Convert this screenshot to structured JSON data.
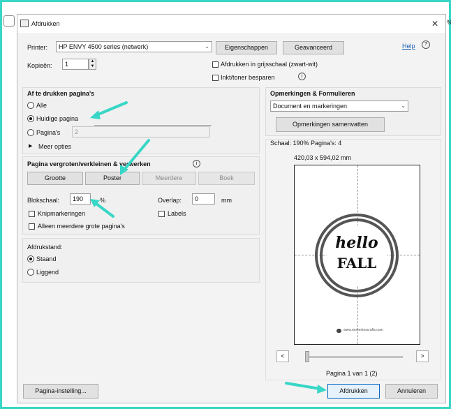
{
  "window": {
    "title": "Afdrukken",
    "close_glyph": "✕"
  },
  "printer": {
    "label": "Printer:",
    "selected": "HP ENVY 4500 series (netwerk)",
    "properties_button": "Eigenschappen",
    "advanced_button": "Geavanceerd",
    "help_link": "Help",
    "copies_label": "Kopieën:",
    "copies_value": "1",
    "grayscale_label": "Afdrukken in grijsschaal (zwart-wit)",
    "save_ink_label": "Inkt/toner besparen"
  },
  "pages": {
    "heading": "Af te drukken pagina's",
    "all": "Alle",
    "current": "Huidige pagina",
    "pages": "Pagina's",
    "pages_value": "2",
    "more": "Meer opties"
  },
  "scaling": {
    "heading": "Pagina vergroten/verkleinen & verwerken",
    "buttons": [
      "Grootte",
      "Poster",
      "Meerdere",
      "Boek"
    ],
    "tile_scale_label": "Blokschaal:",
    "tile_scale_value": "190",
    "percent": "%",
    "overlap_label": "Overlap:",
    "overlap_value": "0",
    "overlap_unit": "mm",
    "cut_marks": "Knipmarkeringen",
    "labels": "Labels",
    "large_only": "Alleen meerdere grote pagina's"
  },
  "orientation": {
    "heading": "Afdrukstand:",
    "portrait": "Staand",
    "landscape": "Liggend"
  },
  "comments": {
    "heading": "Opmerkingen & Formulieren",
    "selected": "Document en markeringen",
    "summarize_button": "Opmerkingen samenvatten"
  },
  "preview": {
    "scale_info": "Schaal: 190% Pagina's: 4",
    "dimensions": "420,03 x 594,02 mm",
    "art_line1": "hello",
    "art_line2": "FALL",
    "art_footer": "www.mommiescrafts.com",
    "prev": "<",
    "next": ">",
    "page_info": "Pagina 1 van 1 (2)",
    "slider_position": 0
  },
  "footer": {
    "page_setup": "Pagina-instelling...",
    "print": "Afdrukken",
    "cancel": "Annuleren"
  },
  "background": {
    "edge_text": "%"
  },
  "colors": {
    "accent": "#38d6c6",
    "link": "#1a5fb4",
    "primary_border": "#0a66c2"
  }
}
